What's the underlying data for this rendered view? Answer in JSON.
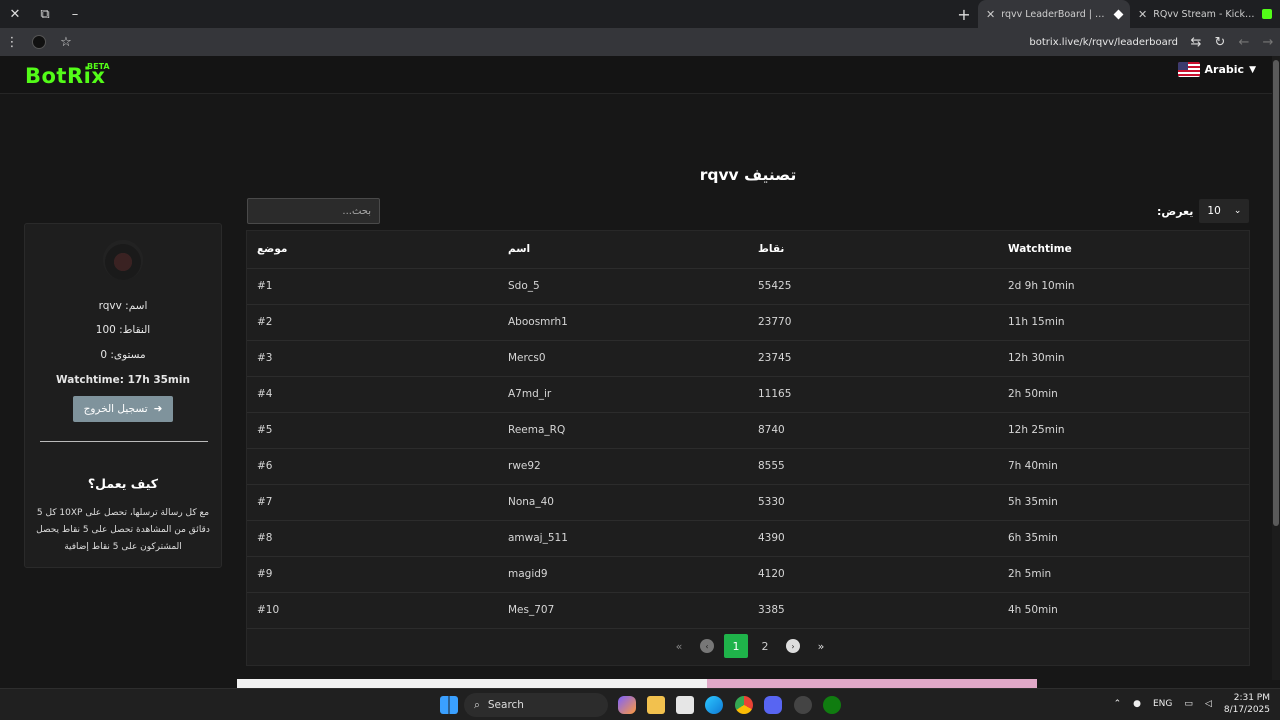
{
  "browser": {
    "window_controls": [
      "✕",
      "⧉",
      "–"
    ],
    "tabs": [
      {
        "title": "rqvv LeaderBoard | The best Ch",
        "active": true
      },
      {
        "title": "RQvv Stream - Kick Dashboard",
        "active": false
      }
    ],
    "url": "botrix.live/k/rqvv/leaderboard"
  },
  "header": {
    "logo": "BotRix",
    "beta": "BETA",
    "language": "Arabic"
  },
  "page": {
    "title": "تصنيف rqvv",
    "search_placeholder": "بحث...",
    "show_label": "يعرض:",
    "show_value": "10"
  },
  "sidebar": {
    "name_line": "اسم: rqvv",
    "points_line": "النقاط: 100",
    "level_line": "مستوى: 0",
    "watchtime_line": "Watchtime: 17h 35min",
    "logout_label": "تسجيل الخروج",
    "how_title": "كيف يعمل؟",
    "how_desc": "مع كل رسالة ترسلها، تحصل على 10XP كل 5 دقائق من المشاهدة تحصل على 5 نقاط يحصل المشتركون على 5 نقاط إضافية"
  },
  "table": {
    "headers": [
      "موضع",
      "اسم",
      "نقاط",
      "Watchtime"
    ],
    "rows": [
      [
        "#1",
        "Sdo_5",
        "55425",
        "2d 9h 10min"
      ],
      [
        "#2",
        "Aboosmrh1",
        "23770",
        "11h 15min"
      ],
      [
        "#3",
        "Mercs0",
        "23745",
        "12h 30min"
      ],
      [
        "#4",
        "A7md_ir",
        "11165",
        "2h 50min"
      ],
      [
        "#5",
        "Reema_RQ",
        "8740",
        "12h 25min"
      ],
      [
        "#6",
        "rwe92",
        "8555",
        "7h 40min"
      ],
      [
        "#7",
        "Nona_40",
        "5330",
        "5h 35min"
      ],
      [
        "#8",
        "amwaj_511",
        "4390",
        "6h 35min"
      ],
      [
        "#9",
        "magid9",
        "4120",
        "2h 5min"
      ],
      [
        "#10",
        "Mes_707",
        "3385",
        "4h 50min"
      ]
    ]
  },
  "pagination": {
    "first": "«",
    "prev": "‹",
    "pages": [
      "1",
      "2"
    ],
    "current": "1",
    "next": "›",
    "last": "»"
  },
  "taskbar": {
    "search_label": "Search",
    "lang": "ENG",
    "time": "2:31 PM",
    "date": "8/17/2025"
  },
  "colors": {
    "brand": "#53fc18",
    "active_page": "#1fb34a",
    "logout_button": "#7f939c"
  }
}
